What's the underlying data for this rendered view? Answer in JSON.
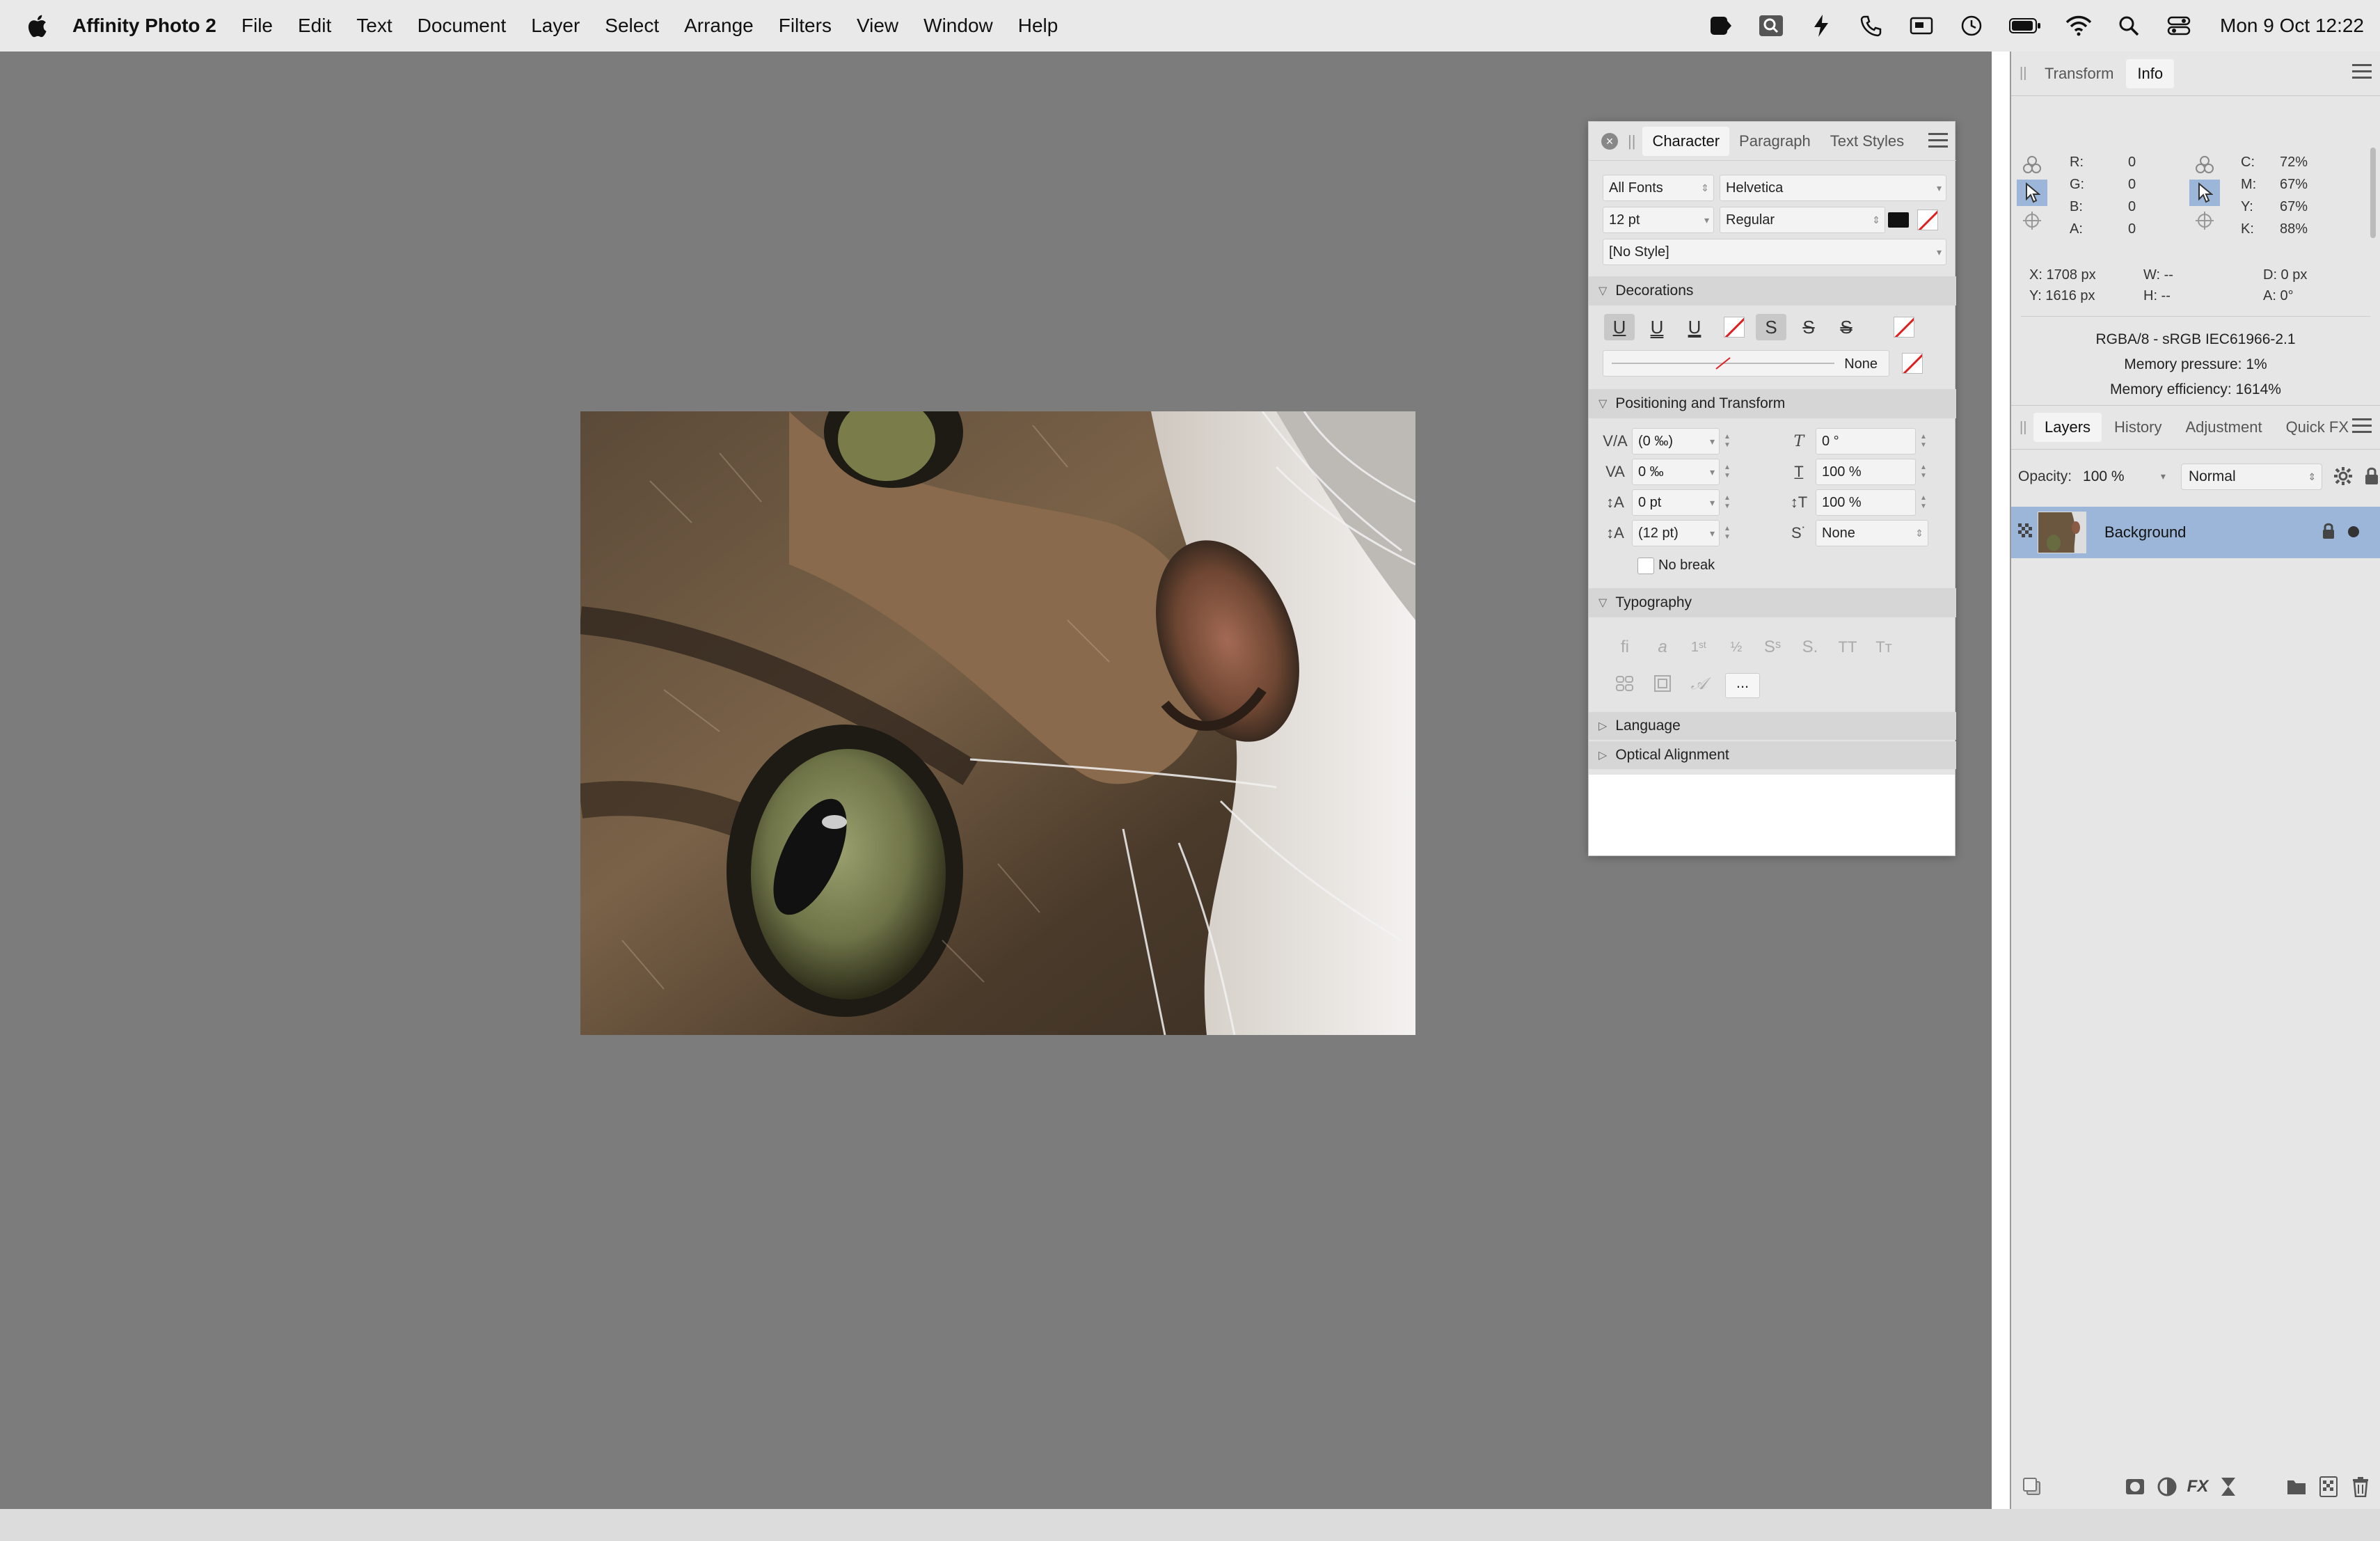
{
  "menubar": {
    "app_name": "Affinity Photo 2",
    "items": [
      "File",
      "Edit",
      "Text",
      "Document",
      "Layer",
      "Select",
      "Arrange",
      "Filters",
      "View",
      "Window",
      "Help"
    ],
    "clock": "Mon 9 Oct  12:22"
  },
  "studio": {
    "top_tabs": [
      "Transform",
      "Info"
    ],
    "info": {
      "r_label": "R:",
      "r": "0",
      "g_label": "G:",
      "g": "0",
      "b_label": "B:",
      "b": "0",
      "a_label": "A:",
      "a": "0",
      "c_label": "C:",
      "c": "72%",
      "m_label": "M:",
      "m": "67%",
      "y_label": "Y:",
      "y": "67%",
      "k_label": "K:",
      "k": "88%",
      "x_pos": "X: 1708 px",
      "y_pos": "Y: 1616 px",
      "w": "W: --",
      "h": "H: --",
      "d": "D: 0 px",
      "angle": "A: 0°",
      "color_format": "RGBA/8 - sRGB IEC61966-2.1",
      "memory_pressure": "Memory pressure: 1%",
      "memory_efficiency": "Memory efficiency: 1614%"
    },
    "layer_tabs": [
      "Layers",
      "History",
      "Adjustment",
      "Quick FX"
    ],
    "layers": {
      "opacity_label": "Opacity:",
      "opacity_value": "100 %",
      "blend_mode": "Normal",
      "items": [
        {
          "name": "Background"
        }
      ]
    }
  },
  "character_panel": {
    "tabs": [
      "Character",
      "Paragraph",
      "Text Styles"
    ],
    "font_collection": "All Fonts",
    "font_family": "Helvetica",
    "font_size": "12 pt",
    "font_style": "Regular",
    "text_style": "[No Style]",
    "sections": {
      "decorations": "Decorations",
      "positioning": "Positioning and Transform",
      "typography": "Typography",
      "language": "Language",
      "optical": "Optical Alignment"
    },
    "decoration_line_value": "None",
    "positioning": {
      "kerning": "(0 ‰)",
      "tracking": "0 ‰",
      "baseline": "0 pt",
      "leading": "(12 pt)",
      "shear": "0 °",
      "h_scale": "100 %",
      "v_scale": "100 %",
      "position": "None",
      "no_break": "No break"
    },
    "typography_more": "...",
    "colors": {
      "fill": "#111111",
      "accent": "#9bb6d8"
    }
  }
}
